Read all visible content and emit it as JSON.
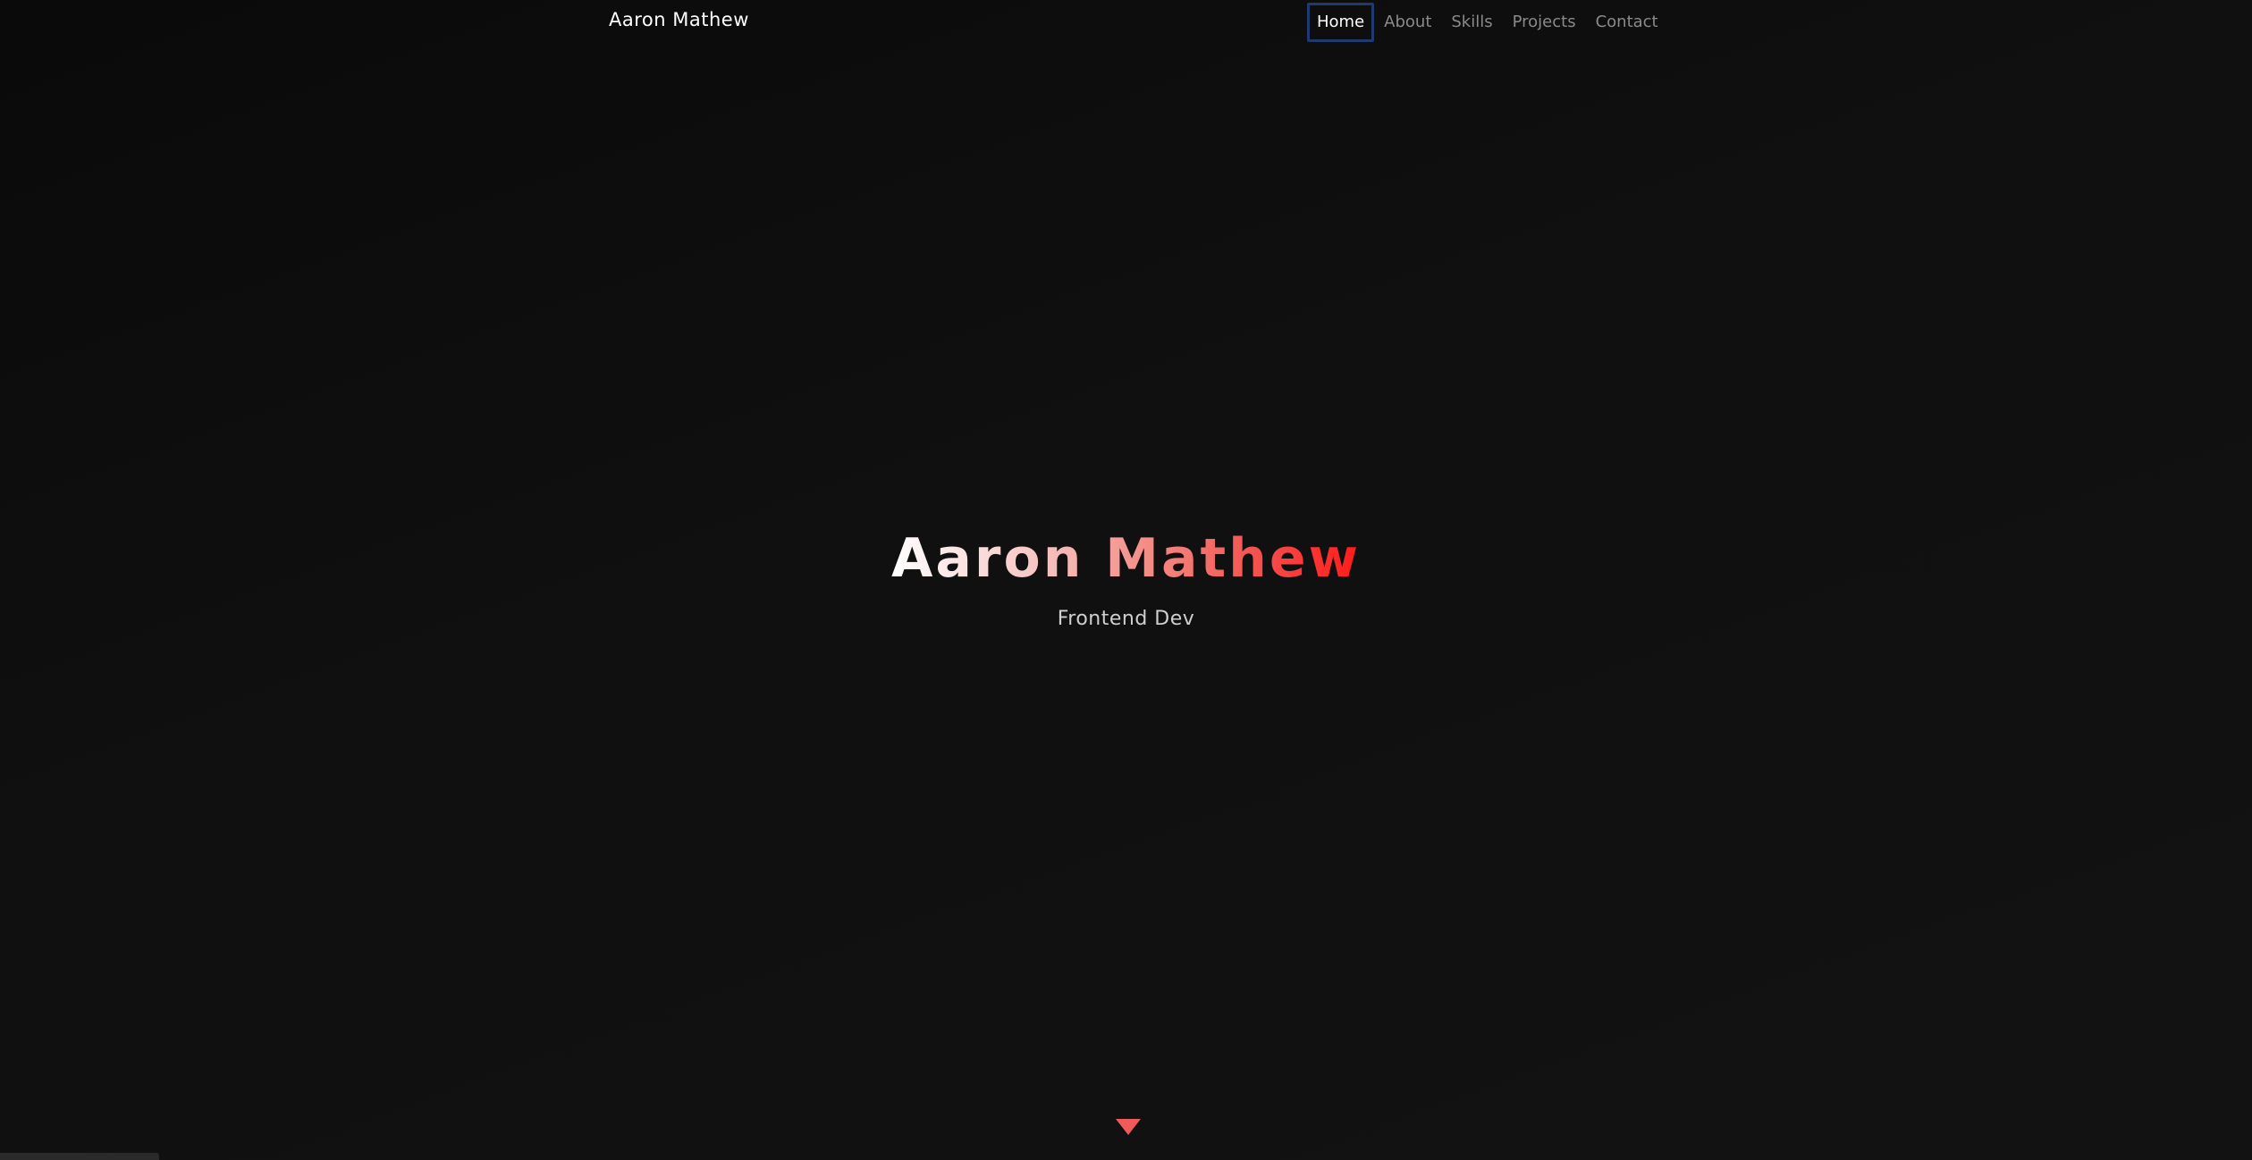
{
  "navbar": {
    "brand": "Aaron Mathew",
    "links": [
      {
        "label": "Home",
        "active": true
      },
      {
        "label": "About",
        "active": false
      },
      {
        "label": "Skills",
        "active": false
      },
      {
        "label": "Projects",
        "active": false
      },
      {
        "label": "Contact",
        "active": false
      }
    ]
  },
  "hero": {
    "title": "Aaron Mathew",
    "subtitle": "Frontend Dev"
  },
  "scroll": {
    "icon": "caret-down-icon"
  },
  "colors": {
    "background": "#0d0d0d",
    "accent": "#f15a5a",
    "active_outline": "#1e3a6e",
    "nav_inactive": "#8a8a8a"
  }
}
